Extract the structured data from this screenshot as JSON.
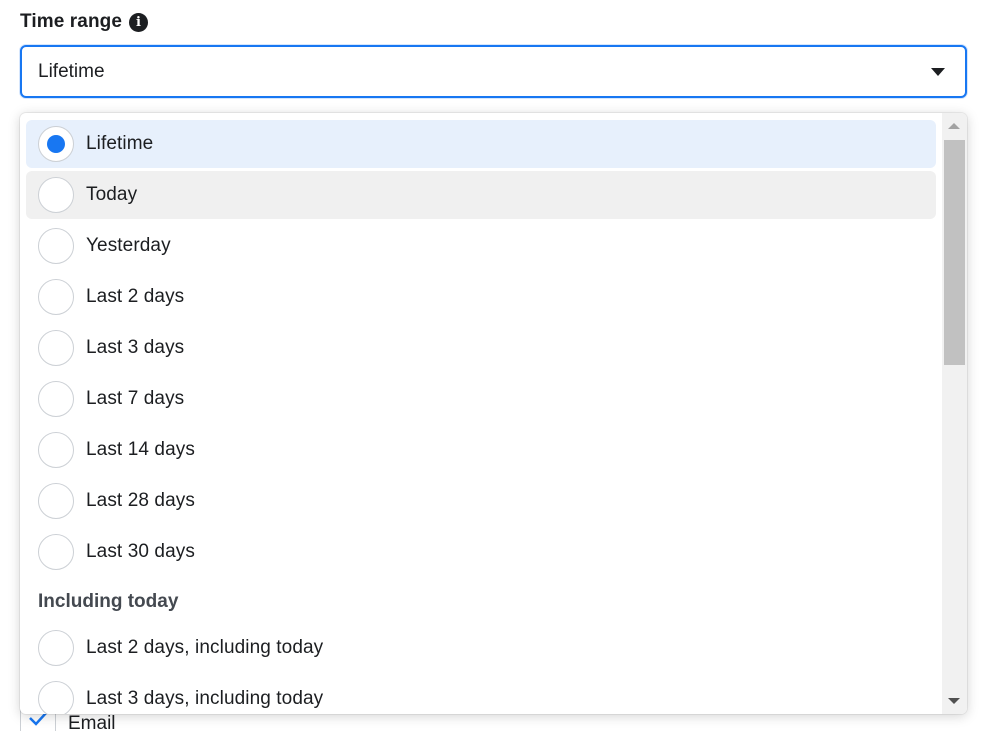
{
  "field": {
    "label": "Time range",
    "info_icon": "i",
    "selected_value": "Lifetime"
  },
  "dropdown": {
    "options": [
      {
        "label": "Lifetime",
        "selected": true
      },
      {
        "label": "Today",
        "hovered": true
      },
      {
        "label": "Yesterday"
      },
      {
        "label": "Last 2 days"
      },
      {
        "label": "Last 3 days"
      },
      {
        "label": "Last 7 days"
      },
      {
        "label": "Last 14 days"
      },
      {
        "label": "Last 28 days"
      },
      {
        "label": "Last 30 days"
      }
    ],
    "section_header": "Including today",
    "section_options": [
      {
        "label": "Last 2 days, including today"
      },
      {
        "label": "Last 3 days, including today"
      }
    ]
  },
  "underlying": {
    "checkbox_label": "Email"
  },
  "colors": {
    "accent": "#1877f2",
    "selected_bg": "#e7f0fc",
    "hover_bg": "#f0f0f0"
  }
}
